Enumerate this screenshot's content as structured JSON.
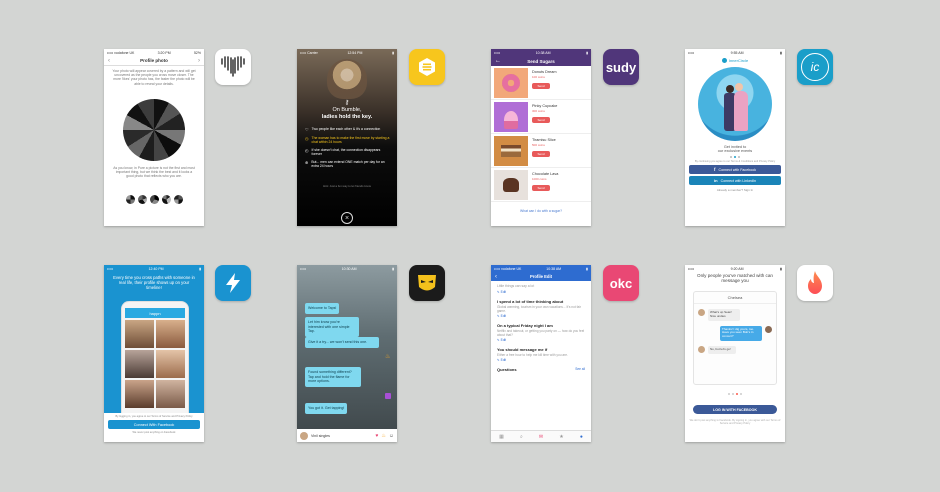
{
  "apps": {
    "happn": {
      "status": {
        "carrier": "••••• vodafone UK",
        "time": "3:20 PM",
        "battery": "52%"
      },
      "title": "Profile photo",
      "intro": "Your photo will appear covered by a pattern and will get uncovered as the people you cross move closer. The more 'likes' your photo has, the faster the photo will be able to reveal your details.",
      "body": "As you know, in Pure a picture is not the first and most important thing, but we think the best and it looks a good photo that reflects who you are."
    },
    "bumble": {
      "status": {
        "carrier": "••••• Carrier",
        "time": "12:54 PM"
      },
      "headline": "On Bumble,",
      "headline2": "ladies hold the key.",
      "points": [
        "Two people like each other & it's a connection",
        "The woman has to make the first move by starting a chat within 24 hours",
        "If she doesn't chat, the connection disappears forever",
        "But... men can extend ONE match per day for an extra 24 hours"
      ],
      "footnote": "Hint: Just a fun way to let friends know"
    },
    "sudy": {
      "status": {
        "time": "10:38 AM"
      },
      "title": "Send Sugars",
      "items": [
        {
          "name": "Donuts Dream",
          "price": "100 coins",
          "action": "Send"
        },
        {
          "name": "Pinky Cupcake",
          "price": "300 coins",
          "action": "Send"
        },
        {
          "name": "Tiramisu Slice",
          "price": "500 coins",
          "action": "Send"
        },
        {
          "name": "Chocolate Lava",
          "price": "1000 coins",
          "action": "Send"
        }
      ],
      "footer_link": "What can I do with a sugar?"
    },
    "innercircle": {
      "status": {
        "time": "9:55 AM"
      },
      "brand": "InnerCircle",
      "caption1": "Get invited to",
      "caption2": "our exclusive events",
      "fine_print": "By continuing you agree to our Terms & Conditions and Privacy Policy",
      "facebook_btn": "Connect with Facebook",
      "linkedin_btn": "Connect with LinkedIn",
      "already_member": "Already a member? Sign In"
    },
    "happn2": {
      "status": {
        "time": "12:40 PM"
      },
      "headline": "Every time you cross paths with someone in real life, their profile shows up on your timeline!",
      "brand": "happn",
      "legal": "By logging in, you agree to our Terms of Service and Privacy Policy",
      "facebook_btn": "Connect With Facebook",
      "notice": "We never post anything on Facebook"
    },
    "grindr": {
      "status": {
        "time": "10:30 AM"
      },
      "messages": [
        "Welcome to Taps!",
        "Let him know you're interested with one simple Tap.",
        "Give it a try... we won't send this one.",
        "Found something different? Tap and hold the flame for more options.",
        "You got it. Get tapping!"
      ],
      "footer_name": "Vinil singles"
    },
    "okcupid": {
      "status": {
        "carrier": "••••• vodafone UK",
        "time": "10:38 AM"
      },
      "title": "Profile Edit",
      "top_prompt": "Little things can say a lot",
      "edit": "Edit",
      "sections": [
        {
          "q": "I spend a lot of time thinking about",
          "a": "Global warming, tourism in your own vacations... It's not fair game."
        },
        {
          "q": "On a typical Friday night I am",
          "a": "Netflix and takeout, or getting you party on — how do you feel about that?"
        },
        {
          "q": "You should message me if",
          "a": "Either a free hour to help me kill time with you are."
        }
      ],
      "questions_label": "Questions",
      "see_all": "See all"
    },
    "tinder": {
      "status": {
        "time": "9:20 AM"
      },
      "headline": "Only people you've matched with can message you",
      "match_name": "Chelsea",
      "chat": [
        {
          "side": "left",
          "text": "What's up Sean! Nice undies"
        },
        {
          "side": "right",
          "text": "Thanks! I dig yours, too. Have you seen Bob's in concert?"
        },
        {
          "side": "left",
          "text": "No, but let's go!"
        }
      ],
      "login_btn": "LOG IN WITH FACEBOOK",
      "legal": "We don't post anything to Facebook. By signing in, you agree with our Terms of Service and Privacy Policy"
    }
  },
  "icons": {
    "happn": "heart-waves-icon",
    "bumble": "hive-icon",
    "sudy": "sudy-logo",
    "innercircle": "ic-logo",
    "happn2": "lightning-icon",
    "grindr": "mask-icon",
    "okcupid": "okc-logo",
    "tinder": "flame-icon"
  },
  "icon_text": {
    "sudy": "sudy",
    "innercircle": "ic",
    "okcupid": "okc"
  },
  "colors": {
    "background": "#d3d5d3",
    "bumble_yellow": "#f7c61d",
    "sudy_purple": "#50367a",
    "sudy_red": "#e85a5a",
    "innercircle_blue": "#1a9ec9",
    "happn_orange": "#f26a3b",
    "happn_blue": "#1a93d0",
    "grindr_black": "#1b1b1b",
    "okc_pink": "#e94874",
    "okc_blue": "#2e6cd0",
    "tinder_orange": "#fd5b4c",
    "facebook_blue": "#3b5998"
  }
}
